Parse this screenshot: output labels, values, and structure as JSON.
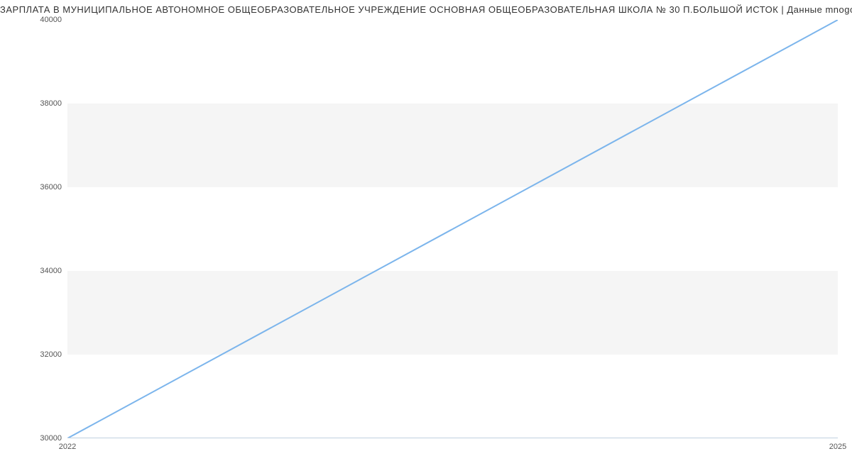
{
  "chart_data": {
    "type": "line",
    "title": "ЗАРПЛАТА В МУНИЦИПАЛЬНОЕ АВТОНОМНОЕ ОБЩЕОБРАЗОВАТЕЛЬНОЕ УЧРЕЖДЕНИЕ ОСНОВНАЯ ОБЩЕОБРАЗОВАТЕЛЬНАЯ ШКОЛА № 30 П.БОЛЬШОЙ ИСТОК | Данные mnogodetey.ru",
    "x": [
      2022,
      2025
    ],
    "values": [
      30000,
      40000
    ],
    "xlabel": "",
    "ylabel": "",
    "y_ticks": [
      30000,
      32000,
      34000,
      36000,
      38000,
      40000
    ],
    "x_ticks": [
      2022,
      2025
    ],
    "xlim": [
      2022,
      2025
    ],
    "ylim": [
      30000,
      40000
    ],
    "alternating_bands": true,
    "colors": {
      "line": "#7cb5ec",
      "band": "#f5f5f5"
    }
  }
}
